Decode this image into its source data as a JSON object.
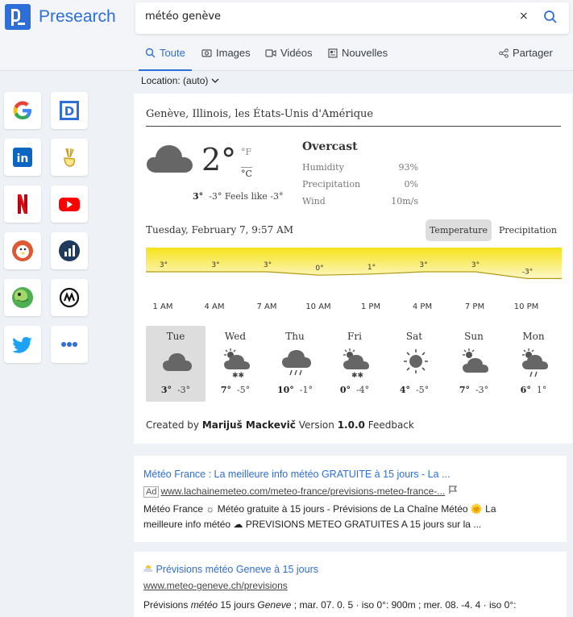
{
  "brand": {
    "name": "Presearch",
    "accent": "#2d6ed8"
  },
  "search": {
    "query": "météo genève",
    "clear_label": "×"
  },
  "tabs": [
    {
      "label": "Toute",
      "icon": "search-icon"
    },
    {
      "label": "Images",
      "icon": "image-icon"
    },
    {
      "label": "Vidéos",
      "icon": "video-icon"
    },
    {
      "label": "Nouvelles",
      "icon": "newspaper-icon"
    }
  ],
  "share_label": "Partager",
  "location": {
    "label": "Location: (auto)"
  },
  "sidebar": [
    {
      "name": "google",
      "icon": "google-icon"
    },
    {
      "name": "dictionary",
      "icon": "dictionary-icon"
    },
    {
      "name": "linkedin",
      "icon": "linkedin-icon"
    },
    {
      "name": "angellist",
      "icon": "angellist-icon"
    },
    {
      "name": "netflix",
      "icon": "netflix-icon"
    },
    {
      "name": "youtube",
      "icon": "youtube-icon"
    },
    {
      "name": "duckduckgo",
      "icon": "duckduckgo-icon"
    },
    {
      "name": "coinranking",
      "icon": "coinranking-icon"
    },
    {
      "name": "frog",
      "icon": "frog-icon"
    },
    {
      "name": "coinmarketcap",
      "icon": "coinmarketcap-icon"
    },
    {
      "name": "twitter",
      "icon": "twitter-icon"
    },
    {
      "name": "more",
      "icon": "more-icon"
    }
  ],
  "weather": {
    "place": "Genève, Illinois, les États-Unis d'Amérique",
    "temp": "2°",
    "unit_f": "°F",
    "unit_c": "°C",
    "feels_hi": "3°",
    "feels_text": "-3° Feels like -3°",
    "condition": "Overcast",
    "stats": [
      {
        "label": "Humidity",
        "value": "93%"
      },
      {
        "label": "Precipitation",
        "value": "0%"
      },
      {
        "label": "Wind",
        "value": "10m/s"
      }
    ],
    "datetime": "Tuesday, February 7, 9:57 AM",
    "toggle": {
      "temperature": "Temperature",
      "precipitation": "Precipitation"
    },
    "hourly_temps": [
      "3°",
      "3°",
      "3°",
      "0°",
      "1°",
      "3°",
      "3°",
      "-3°"
    ],
    "hourly_values": [
      3,
      3,
      3,
      0,
      1,
      3,
      3,
      -3
    ],
    "hours": [
      "1 AM",
      "4 AM",
      "7 AM",
      "10 AM",
      "1 PM",
      "4 PM",
      "7 PM",
      "10 PM"
    ],
    "days": [
      {
        "name": "Tue",
        "hi": "3°",
        "lo": "-3°",
        "icon": "cloud-icon"
      },
      {
        "name": "Wed",
        "hi": "7°",
        "lo": "-5°",
        "icon": "sun-cloud-snow-icon"
      },
      {
        "name": "Thu",
        "hi": "10°",
        "lo": "-1°",
        "icon": "cloud-rain-icon"
      },
      {
        "name": "Fri",
        "hi": "0°",
        "lo": "-4°",
        "icon": "sun-cloud-snow-icon"
      },
      {
        "name": "Sat",
        "hi": "4°",
        "lo": "-5°",
        "icon": "sun-icon"
      },
      {
        "name": "Sun",
        "hi": "7°",
        "lo": "-3°",
        "icon": "sun-cloud-icon"
      },
      {
        "name": "Mon",
        "hi": "6°",
        "lo": "1°",
        "icon": "sun-cloud-rain-icon"
      }
    ],
    "credit": {
      "prefix": "Created by",
      "author": "Marijuš Mackevič",
      "version_label": "Version",
      "version": "1.0.0",
      "feedback": "Feedback"
    }
  },
  "results": [
    {
      "title": "Météo France : La meilleure info météo GRATUITE à 15 jours - La ...",
      "ad": "Ad",
      "url": "www.lachainemeteo.com/meteo-france/previsions-meteo-france-...",
      "snippet_1": "Météo France ☼ Météo gratuite à 15 jours - Prévisions de La Chaîne Météo 🌞 La",
      "snippet_2": "meilleure info météo ☁ PREVISIONS METEO GRATUITES A 15 jours sur la ..."
    },
    {
      "title": "Prévisions météo Geneve à 15 jours",
      "url": "www.meteo-geneve.ch/previsions",
      "snippet_a": "Prévisions ",
      "snippet_em1": "météo",
      "snippet_b": " 15 jours ",
      "snippet_em2": "Geneve",
      "snippet_c": " ; mar. 07. 0. 5 · iso 0°: 900m ; mer. 08. -4. 4 · iso 0°:"
    }
  ]
}
